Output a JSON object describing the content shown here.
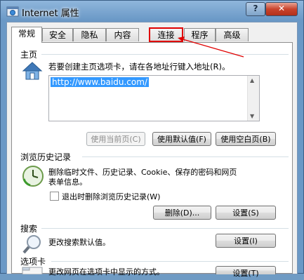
{
  "window": {
    "title": "Internet 属性",
    "help_label": "?",
    "close_label": "✕"
  },
  "tabs": [
    {
      "label": "常规",
      "active": true
    },
    {
      "label": "安全"
    },
    {
      "label": "隐私"
    },
    {
      "label": "内容"
    },
    {
      "label": "连接",
      "highlighted": true
    },
    {
      "label": "程序"
    },
    {
      "label": "高级"
    }
  ],
  "home": {
    "group_title": "主页",
    "icon": "house-icon",
    "description": "若要创建主页选项卡，请在各地址行键入地址(R)。",
    "url": "http://www.baidu.com/",
    "btn_current": "使用当前页(C)",
    "btn_default": "使用默认值(F)",
    "btn_blank": "使用空白页(B)"
  },
  "history": {
    "group_title": "浏览历史记录",
    "icon": "clock-icon",
    "description_line1": "删除临时文件、历史记录、Cookie、保存的密码和网页",
    "description_line2": "表单信息。",
    "checkbox_label": "退出时删除浏览历史记录(W)",
    "btn_delete": "删除(D)...",
    "btn_settings": "设置(S)"
  },
  "search": {
    "group_title": "搜索",
    "icon": "magnifier-icon",
    "description": "更改搜索默认值。",
    "btn_settings": "设置(I)"
  },
  "tabs_section": {
    "group_title": "选项卡",
    "icon": "tabs-icon",
    "description": "更改网页在选项卡中显示的方式。",
    "btn_settings": "设置(T)"
  },
  "colors": {
    "highlight": "#e00000",
    "selection": "#3399ff"
  }
}
